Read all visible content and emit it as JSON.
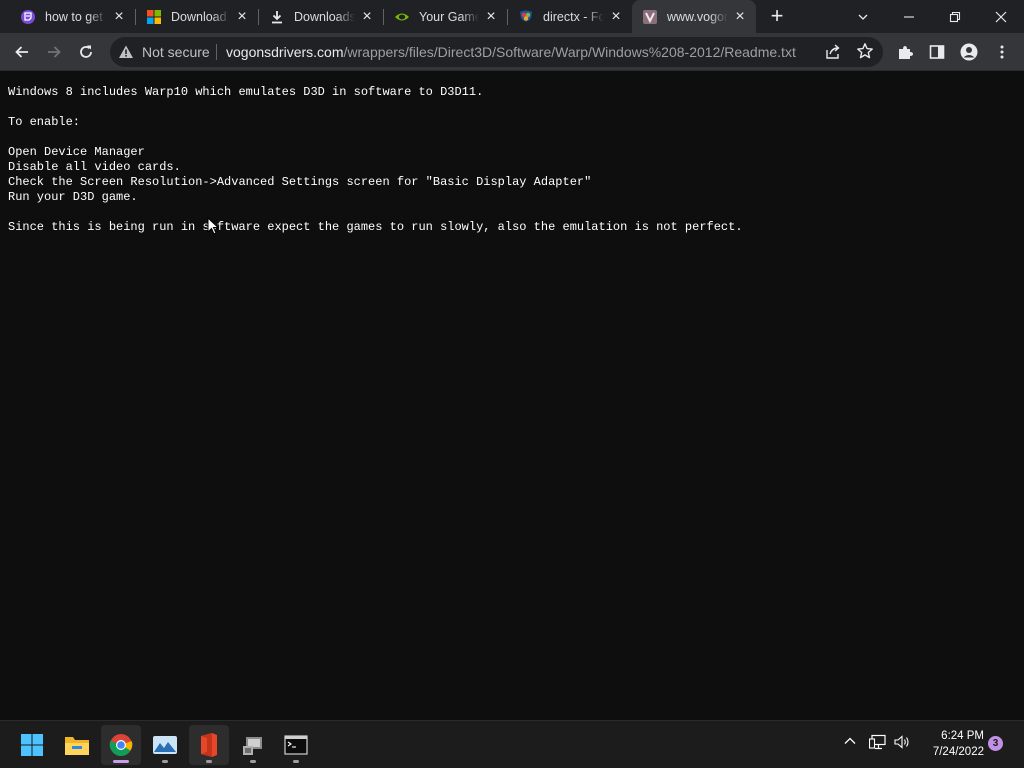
{
  "browser": {
    "tabs": [
      {
        "title": "how to get",
        "icon": "twitch-icon",
        "active": false
      },
      {
        "title": "Download",
        "icon": "microsoft-icon",
        "active": false
      },
      {
        "title": "Downloads",
        "icon": "download-icon",
        "active": false
      },
      {
        "title": "Your Game",
        "icon": "nvidia-icon",
        "active": false
      },
      {
        "title": "directx - Fo",
        "icon": "stackexchange-icon",
        "active": false
      },
      {
        "title": "www.vogon",
        "icon": "vogons-icon",
        "active": true
      }
    ],
    "omnibox": {
      "security_label": "Not secure",
      "url_host": "vogonsdrivers.com",
      "url_path": "/wrappers/files/Direct3D/Software/Warp/Windows%208-2012/Readme.txt"
    }
  },
  "document": {
    "lines": [
      "Windows 8 includes Warp10 which emulates D3D in software to D3D11.",
      "",
      "To enable:",
      "",
      "Open Device Manager",
      "Disable all video cards.",
      "Check the Screen Resolution->Advanced Settings screen for \"Basic Display Adapter\"",
      "Run your D3D game.",
      "",
      "Since this is being run in software expect the games to run slowly, also the emulation is not perfect."
    ]
  },
  "taskbar": {
    "apps": [
      "start-icon",
      "file-explorer-icon",
      "chrome-icon",
      "photos-icon",
      "office-icon",
      "device-manager-icon",
      "terminal-icon"
    ],
    "clock": {
      "time": "6:24 PM",
      "date": "7/24/2022"
    },
    "notification_count": "3"
  },
  "colors": {
    "page_bg": "#0e0e0e",
    "tabbar_bg": "#202124",
    "toolbar_bg": "#35363a",
    "taskbar_bg": "#1c1c1c",
    "badge": "#c290e5"
  }
}
